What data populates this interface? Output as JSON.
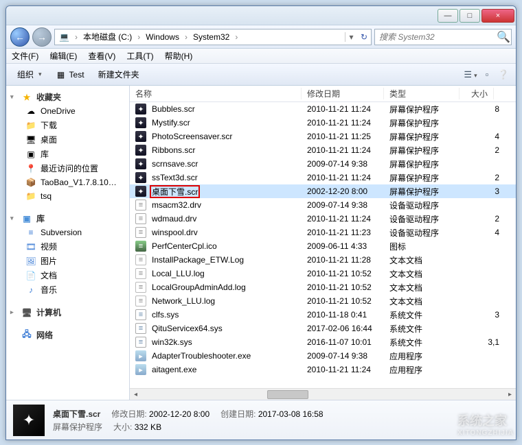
{
  "titlebar": {
    "min": "—",
    "max": "□",
    "close": "×"
  },
  "nav": {
    "back": "←",
    "fwd": "→"
  },
  "breadcrumb": {
    "icon": "💻",
    "segments": [
      "本地磁盘 (C:)",
      "Windows",
      "System32"
    ],
    "sep": "›",
    "drop": "▾",
    "refresh": "↻"
  },
  "search": {
    "placeholder": "搜索 System32",
    "icon": "🔍"
  },
  "menu": [
    "文件(F)",
    "编辑(E)",
    "查看(V)",
    "工具(T)",
    "帮助(H)"
  ],
  "toolbar": {
    "organize": "组织",
    "test": "Test",
    "test_icon": "▦",
    "newfolder": "新建文件夹",
    "view_icon": "☰",
    "preview_icon": "▫",
    "help_icon": "❔"
  },
  "sidebar": {
    "fav": {
      "label": "收藏夹",
      "items": [
        {
          "icon": "cloud",
          "label": "OneDrive"
        },
        {
          "icon": "folder",
          "label": "下载"
        },
        {
          "icon": "desktop",
          "label": "桌面"
        },
        {
          "icon": "lib",
          "label": "库"
        },
        {
          "icon": "recent",
          "label": "最近访问的位置"
        },
        {
          "icon": "archive",
          "label": "TaoBao_V1.7.8.10…"
        },
        {
          "icon": "folder",
          "label": "tsq"
        }
      ]
    },
    "lib": {
      "label": "库",
      "items": [
        {
          "icon": "svn",
          "label": "Subversion"
        },
        {
          "icon": "video",
          "label": "视频"
        },
        {
          "icon": "pic",
          "label": "图片"
        },
        {
          "icon": "doc",
          "label": "文档"
        },
        {
          "icon": "music",
          "label": "音乐"
        }
      ]
    },
    "computer": {
      "label": "计算机"
    },
    "network": {
      "label": "网络"
    }
  },
  "columns": {
    "name": "名称",
    "date": "修改日期",
    "type": "类型",
    "size": "大小"
  },
  "files": [
    {
      "icon": "scr",
      "name": "Bubbles.scr",
      "date": "2010-11-21 11:24",
      "type": "屏幕保护程序",
      "size": "8"
    },
    {
      "icon": "scr",
      "name": "Mystify.scr",
      "date": "2010-11-21 11:24",
      "type": "屏幕保护程序",
      "size": ""
    },
    {
      "icon": "scr",
      "name": "PhotoScreensaver.scr",
      "date": "2010-11-21 11:25",
      "type": "屏幕保护程序",
      "size": "4"
    },
    {
      "icon": "scr",
      "name": "Ribbons.scr",
      "date": "2010-11-21 11:24",
      "type": "屏幕保护程序",
      "size": "2"
    },
    {
      "icon": "scr",
      "name": "scrnsave.scr",
      "date": "2009-07-14 9:38",
      "type": "屏幕保护程序",
      "size": ""
    },
    {
      "icon": "scr",
      "name": "ssText3d.scr",
      "date": "2010-11-21 11:24",
      "type": "屏幕保护程序",
      "size": "2"
    },
    {
      "icon": "scr",
      "name": "桌面下雪.scr",
      "date": "2002-12-20 8:00",
      "type": "屏幕保护程序",
      "size": "3",
      "selected": true
    },
    {
      "icon": "drv",
      "name": "msacm32.drv",
      "date": "2009-07-14 9:38",
      "type": "设备驱动程序",
      "size": ""
    },
    {
      "icon": "drv",
      "name": "wdmaud.drv",
      "date": "2010-11-21 11:24",
      "type": "设备驱动程序",
      "size": "2"
    },
    {
      "icon": "drv",
      "name": "winspool.drv",
      "date": "2010-11-21 11:23",
      "type": "设备驱动程序",
      "size": "4"
    },
    {
      "icon": "ico",
      "name": "PerfCenterCpl.ico",
      "date": "2009-06-11 4:33",
      "type": "图标",
      "size": ""
    },
    {
      "icon": "log",
      "name": "InstallPackage_ETW.Log",
      "date": "2010-11-21 11:28",
      "type": "文本文档",
      "size": ""
    },
    {
      "icon": "log",
      "name": "Local_LLU.log",
      "date": "2010-11-21 10:52",
      "type": "文本文档",
      "size": ""
    },
    {
      "icon": "log",
      "name": "LocalGroupAdminAdd.log",
      "date": "2010-11-21 10:52",
      "type": "文本文档",
      "size": ""
    },
    {
      "icon": "log",
      "name": "Network_LLU.log",
      "date": "2010-11-21 10:52",
      "type": "文本文档",
      "size": ""
    },
    {
      "icon": "sys",
      "name": "clfs.sys",
      "date": "2010-11-18 0:41",
      "type": "系统文件",
      "size": "3"
    },
    {
      "icon": "sys",
      "name": "QituServicex64.sys",
      "date": "2017-02-06 16:44",
      "type": "系统文件",
      "size": ""
    },
    {
      "icon": "sys",
      "name": "win32k.sys",
      "date": "2016-11-07 10:01",
      "type": "系统文件",
      "size": "3,1"
    },
    {
      "icon": "exe",
      "name": "AdapterTroubleshooter.exe",
      "date": "2009-07-14 9:38",
      "type": "应用程序",
      "size": ""
    },
    {
      "icon": "exe",
      "name": "aitagent.exe",
      "date": "2010-11-21 11:24",
      "type": "应用程序",
      "size": ""
    }
  ],
  "details": {
    "filename": "桌面下雪.scr",
    "filetype": "屏幕保护程序",
    "mod_label": "修改日期:",
    "mod_value": "2002-12-20 8:00",
    "create_label": "创建日期:",
    "create_value": "2017-03-08 16:58",
    "size_label": "大小:",
    "size_value": "332 KB"
  },
  "watermark": {
    "line1": "系统之家",
    "line2": "XITONGZHIJIA"
  }
}
